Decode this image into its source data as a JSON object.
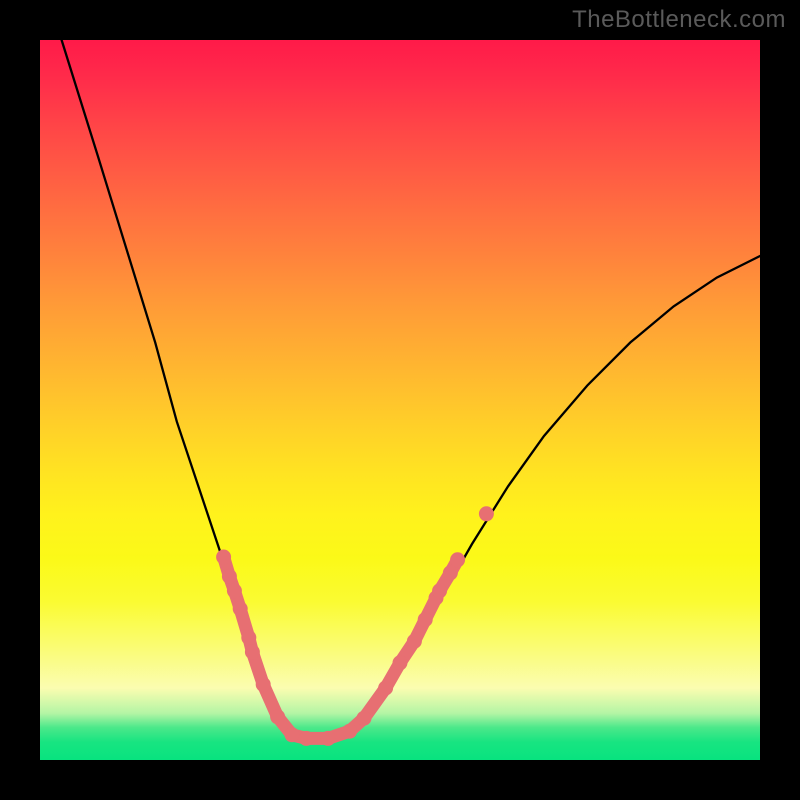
{
  "watermark": "TheBottleneck.com",
  "colors": {
    "background": "#000000",
    "curve": "#000000",
    "marker": "#e76f72",
    "watermark_text": "#5a5a5a"
  },
  "chart_data": {
    "type": "line",
    "title": "",
    "xlabel": "",
    "ylabel": "",
    "xlim": [
      0,
      1
    ],
    "ylim": [
      0,
      1
    ],
    "note": "Axes are unlabeled in the image; x and y are normalized 0–1 (left/bottom → right/top). Values are read off the rendered curves.",
    "series": [
      {
        "name": "curve",
        "x": [
          0.03,
          0.08,
          0.12,
          0.16,
          0.19,
          0.22,
          0.25,
          0.27,
          0.29,
          0.31,
          0.33,
          0.35,
          0.37,
          0.4,
          0.44,
          0.48,
          0.52,
          0.56,
          0.6,
          0.65,
          0.7,
          0.76,
          0.82,
          0.88,
          0.94,
          1.0
        ],
        "y": [
          1.0,
          0.84,
          0.71,
          0.58,
          0.47,
          0.38,
          0.29,
          0.22,
          0.16,
          0.11,
          0.07,
          0.04,
          0.03,
          0.03,
          0.05,
          0.1,
          0.16,
          0.23,
          0.3,
          0.38,
          0.45,
          0.52,
          0.58,
          0.63,
          0.67,
          0.7
        ]
      }
    ],
    "markers": {
      "name": "highlighted-points",
      "color": "#e76f72",
      "x": [
        0.255,
        0.263,
        0.27,
        0.278,
        0.29,
        0.295,
        0.31,
        0.33,
        0.35,
        0.37,
        0.4,
        0.43,
        0.45,
        0.48,
        0.5,
        0.52,
        0.535,
        0.55,
        0.555,
        0.57,
        0.58,
        0.62
      ],
      "y": [
        0.282,
        0.255,
        0.235,
        0.21,
        0.17,
        0.15,
        0.105,
        0.06,
        0.035,
        0.03,
        0.03,
        0.04,
        0.058,
        0.1,
        0.135,
        0.165,
        0.195,
        0.225,
        0.235,
        0.26,
        0.278,
        0.342
      ]
    }
  }
}
